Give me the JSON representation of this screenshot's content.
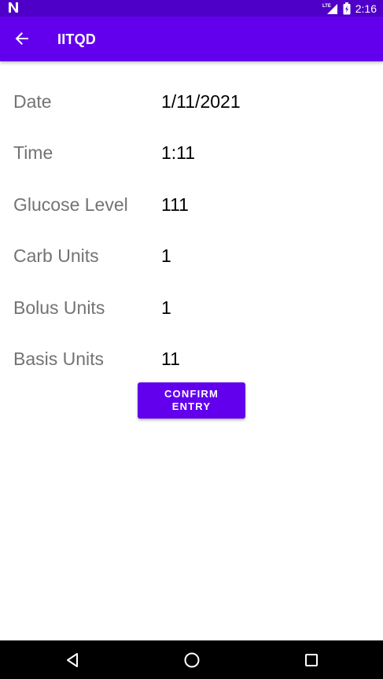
{
  "status_bar": {
    "time": "2:16",
    "network": "LTE",
    "left_icon": "n-notification-icon",
    "background": "#4f00c8"
  },
  "app_bar": {
    "title": "IITQD",
    "back_icon": "back-arrow-icon",
    "background": "#6200ee"
  },
  "form": {
    "rows": [
      {
        "label": "Date",
        "value": "1/11/2021"
      },
      {
        "label": "Time",
        "value": "1:11"
      },
      {
        "label": "Glucose Level",
        "value": "111"
      },
      {
        "label": "Carb Units",
        "value": "1"
      },
      {
        "label": "Bolus Units",
        "value": "1"
      },
      {
        "label": "Basis Units",
        "value": "11"
      }
    ]
  },
  "confirm_button": {
    "label": "CONFIRM ENTRY",
    "color": "#6200ee"
  },
  "nav_bar": {
    "back_icon": "nav-back-triangle-icon",
    "home_icon": "nav-home-circle-icon",
    "recents_icon": "nav-recents-square-icon"
  }
}
